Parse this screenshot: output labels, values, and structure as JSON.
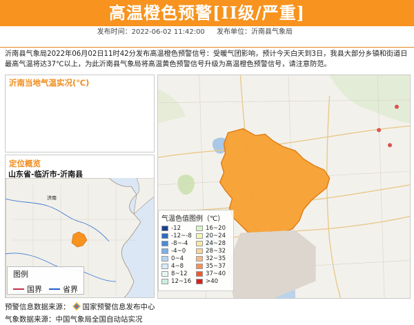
{
  "header": {
    "title": "高温橙色预警[II级/严重]",
    "color": "#f7931e"
  },
  "meta": {
    "issue_time_label": "发布时间：2022-06-02 11:42:00",
    "issuer_label": "发布单位：沂南县气象局"
  },
  "notice": {
    "text": "沂南县气象局2022年06月02日11时42分发布高温橙色预警信号：受暖气团影响，预计今天白天到3日，我县大部分乡镇和街道日最高气温将达37℃以上，为此沂南县气象局将高温黄色预警信号升级为高温橙色预警信号，请注意防范。"
  },
  "temp_panel": {
    "title": "沂南当地气温实况(℃)"
  },
  "location_panel": {
    "title": "定位概览",
    "location": "山东省-临沂市-沂南县",
    "map_label_jinan": "济南",
    "legend_title": "图例",
    "county_boundary": "国界",
    "province_boundary": "省界"
  },
  "temp_legend": {
    "title": "气温色值图例（℃）",
    "items": [
      {
        "label": "-12",
        "color": "#1b3f8e"
      },
      {
        "label": "16~20",
        "color": "#d9f2c8"
      },
      {
        "label": "-12~-8",
        "color": "#2f6bc0"
      },
      {
        "label": "20~24",
        "color": "#f4f6b6"
      },
      {
        "label": "-8~-4",
        "color": "#4c8ad6"
      },
      {
        "label": "24~28",
        "color": "#fbe7a4"
      },
      {
        "label": "-4~0",
        "color": "#7fb0e6"
      },
      {
        "label": "28~32",
        "color": "#fbd39a"
      },
      {
        "label": "0~4",
        "color": "#b4d5f2"
      },
      {
        "label": "32~35",
        "color": "#f9b788"
      },
      {
        "label": "4~8",
        "color": "#d6ebf8"
      },
      {
        "label": "35~37",
        "color": "#f69059"
      },
      {
        "label": "8~12",
        "color": "#e6f6f0"
      },
      {
        "label": "37~40",
        "color": "#ee5a2c"
      },
      {
        "label": "12~16",
        "color": "#cdeedd"
      },
      {
        "label": ">40",
        "color": "#d8201f"
      }
    ]
  },
  "footer": {
    "warning_source_label": "预警信息数据来源：",
    "warning_source": "国家预警信息发布中心",
    "weather_source_label": "气象数据来源：",
    "weather_source": "中国气象局全国自动站实况"
  }
}
